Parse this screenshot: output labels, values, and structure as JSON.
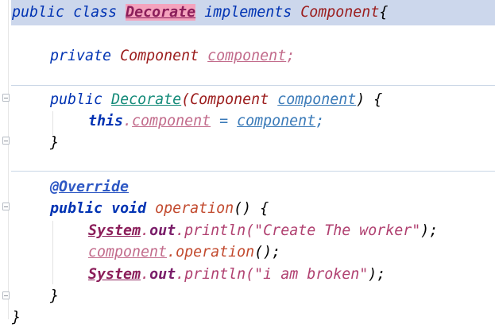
{
  "code": {
    "line1": {
      "kw_public": "public",
      "kw_class": "class",
      "class_name": "Decorate",
      "kw_implements": "implements",
      "interface": "Component",
      "brace": "{"
    },
    "line2": {
      "kw_private": "private",
      "type": "Component",
      "field": "component",
      "semi": ";"
    },
    "line3": {
      "kw_public": "public",
      "ctor": "Decorate",
      "lparen": "(",
      "type": "Component",
      "param": "component",
      "rparen_brace": ") {"
    },
    "line4": {
      "kw_this": "this",
      "dot": ".",
      "field": "component",
      "eq": " = ",
      "param": "component",
      "semi": ";"
    },
    "line5": {
      "brace": "}"
    },
    "line6": {
      "annotation": "@Override"
    },
    "line7": {
      "kw_public": "public",
      "kw_void": "void",
      "method": "operation",
      "paren_brace": "() {"
    },
    "line8": {
      "system": "System",
      "dot1": ".",
      "out": "out",
      "dot2": ".",
      "println": "println",
      "lparen": "(",
      "string": "\"Create The worker\"",
      "end": ");"
    },
    "line9": {
      "field": "component",
      "dot": ".",
      "method": "operation",
      "end": "();"
    },
    "line10": {
      "system": "System",
      "dot1": ".",
      "out": "out",
      "dot2": ".",
      "println": "println",
      "lparen": "(",
      "string": "\"i am broken\"",
      "end": ");"
    },
    "line11": {
      "brace": "}"
    },
    "line12": {
      "brace": "}"
    }
  }
}
